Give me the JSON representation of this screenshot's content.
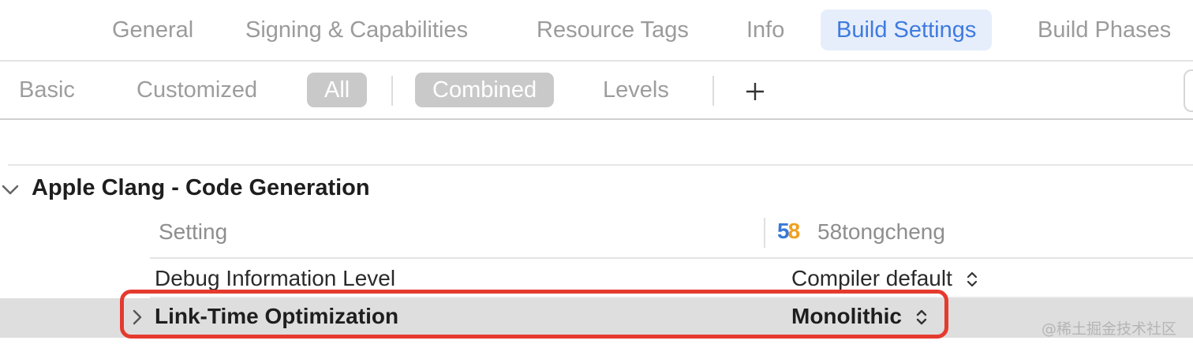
{
  "tabs": [
    {
      "label": "General",
      "active": false
    },
    {
      "label": "Signing & Capabilities",
      "active": false
    },
    {
      "label": "Resource Tags",
      "active": false
    },
    {
      "label": "Info",
      "active": false
    },
    {
      "label": "Build Settings",
      "active": true
    },
    {
      "label": "Build Phases",
      "active": false
    }
  ],
  "filters": {
    "scope": [
      {
        "label": "Basic",
        "selected": false
      },
      {
        "label": "Customized",
        "selected": false
      },
      {
        "label": "All",
        "selected": true
      }
    ],
    "view": [
      {
        "label": "Combined",
        "selected": true
      },
      {
        "label": "Levels",
        "selected": false
      }
    ],
    "add_icon": "plus-icon"
  },
  "section": {
    "title": "Apple Clang - Code Generation",
    "expanded": true,
    "column_setting": "Setting",
    "target_icon_text": {
      "digit1": "5",
      "digit2": "8"
    },
    "target_name": "58tongcheng",
    "rows": [
      {
        "name": "Debug Information Level",
        "value": "Compiler default",
        "bold": false
      },
      {
        "name": "Link-Time Optimization",
        "value": "Monolithic",
        "bold": true
      }
    ]
  },
  "colors": {
    "accent": "#3f7be0",
    "tab_active_bg": "#e6eefb",
    "pill_bg": "#c9c9c9",
    "highlight_outline": "#e53b2f",
    "row_highlight_bg": "#dedede"
  },
  "watermark": "@稀土掘金技术社区"
}
